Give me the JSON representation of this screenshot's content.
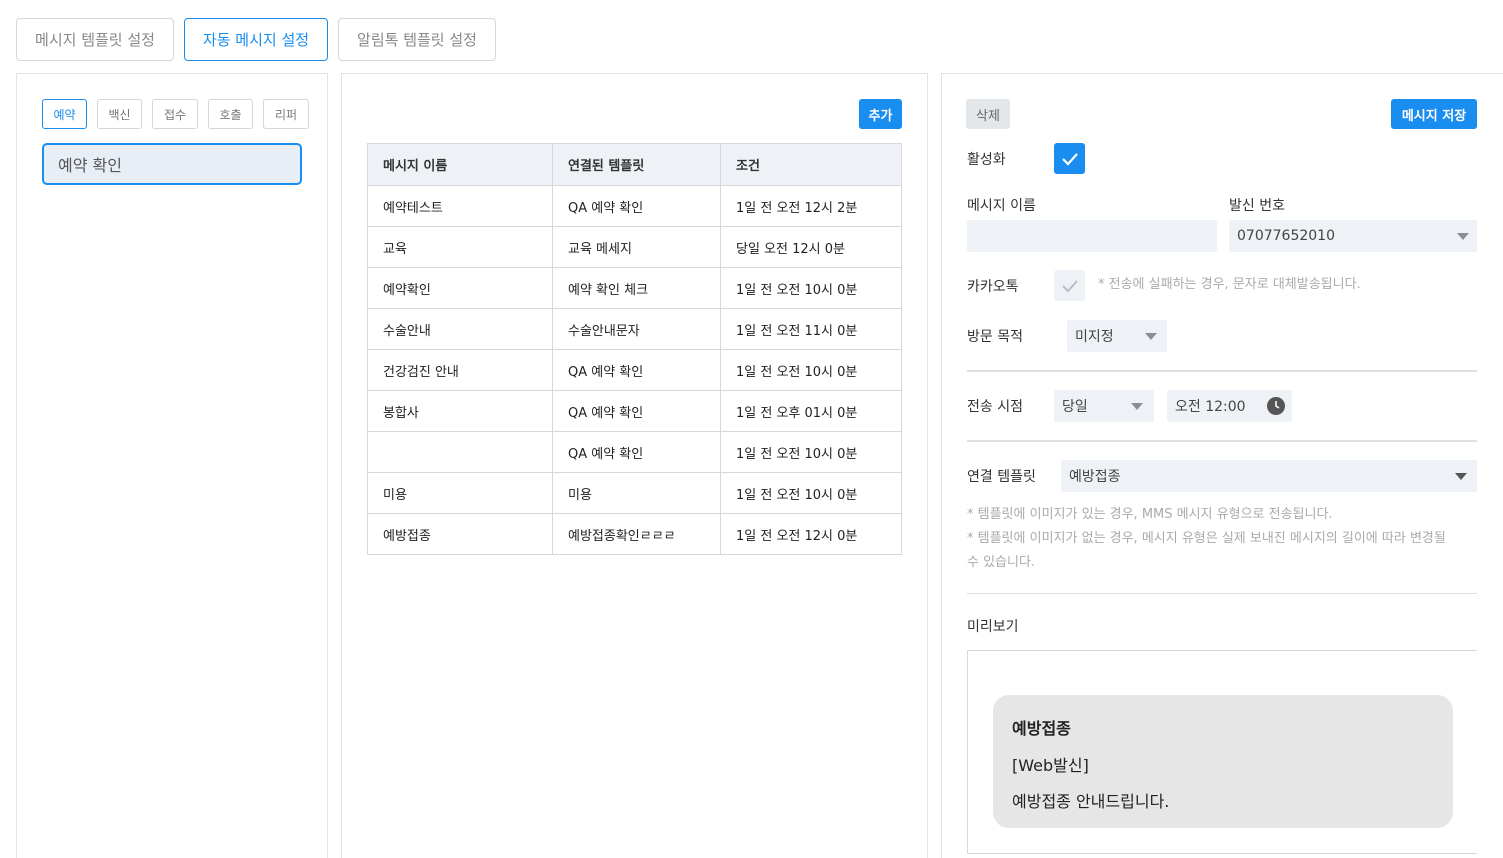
{
  "top_tabs": [
    {
      "label": "메시지 템플릿 설정",
      "active": false
    },
    {
      "label": "자동 메시지 설정",
      "active": true
    },
    {
      "label": "알림톡 템플릿 설정",
      "active": false
    }
  ],
  "categories": [
    "예약",
    "백신",
    "접수",
    "호출",
    "리퍼"
  ],
  "left_list": {
    "selected_item": "예약 확인"
  },
  "middle": {
    "add_button": "추가",
    "columns": [
      "메시지 이름",
      "연결된 템플릿",
      "조건"
    ],
    "rows": [
      [
        "예약테스트",
        "QA 예약 확인",
        "1일 전 오전 12시 2분"
      ],
      [
        "교육",
        "교육 메세지",
        "당일 오전 12시 0분"
      ],
      [
        "예약확인",
        "예약 확인 체크",
        "1일 전 오전 10시 0분"
      ],
      [
        "수술안내",
        "수술안내문자",
        "1일 전 오전 11시 0분"
      ],
      [
        "건강검진 안내",
        "QA 예약 확인",
        "1일 전 오전 10시 0분"
      ],
      [
        "봉합사",
        "QA 예약 확인",
        "1일 전 오후 01시 0분"
      ],
      [
        "",
        "QA 예약 확인",
        "1일 전 오전 10시 0분"
      ],
      [
        "미용",
        "미용",
        "1일 전 오전 10시 0분"
      ],
      [
        "예방접종",
        "예방접종확인ㄹㄹㄹ",
        "1일 전 오전 12시 0분"
      ]
    ]
  },
  "right": {
    "delete_button": "삭제",
    "save_button": "메시지 저장",
    "active_label": "활성화",
    "active_checked": true,
    "name_label": "메시지 이름",
    "name_value": "",
    "sender_label": "발신 번호",
    "sender_value": "07077652010",
    "kakao_label": "카카오톡",
    "kakao_checked": false,
    "kakao_hint": "* 전송에 실패하는 경우, 문자로 대체발송됩니다.",
    "visit_label": "방문 목적",
    "visit_value": "미지정",
    "send_time_label": "전송 시점",
    "send_day_value": "당일",
    "send_time_value": "오전 12:00",
    "template_label": "연결 템플릿",
    "template_value": "예방접종",
    "template_hint_1": "* 템플릿에 이미지가 있는 경우, MMS 메시지 유형으로 전송됩니다.",
    "template_hint_2": "* 템플릿에 이미지가 없는 경우, 메시지 유형은 실제 보내진 메시지의 길이에 따라 변경될",
    "template_hint_3": "수 있습니다.",
    "preview_label": "미리보기",
    "preview": {
      "title": "예방접종",
      "line1": "[Web발신]",
      "line2": "예방접종 안내드립니다."
    }
  },
  "colors": {
    "accent": "#1a8df0",
    "field_bg": "#eef1f5"
  }
}
